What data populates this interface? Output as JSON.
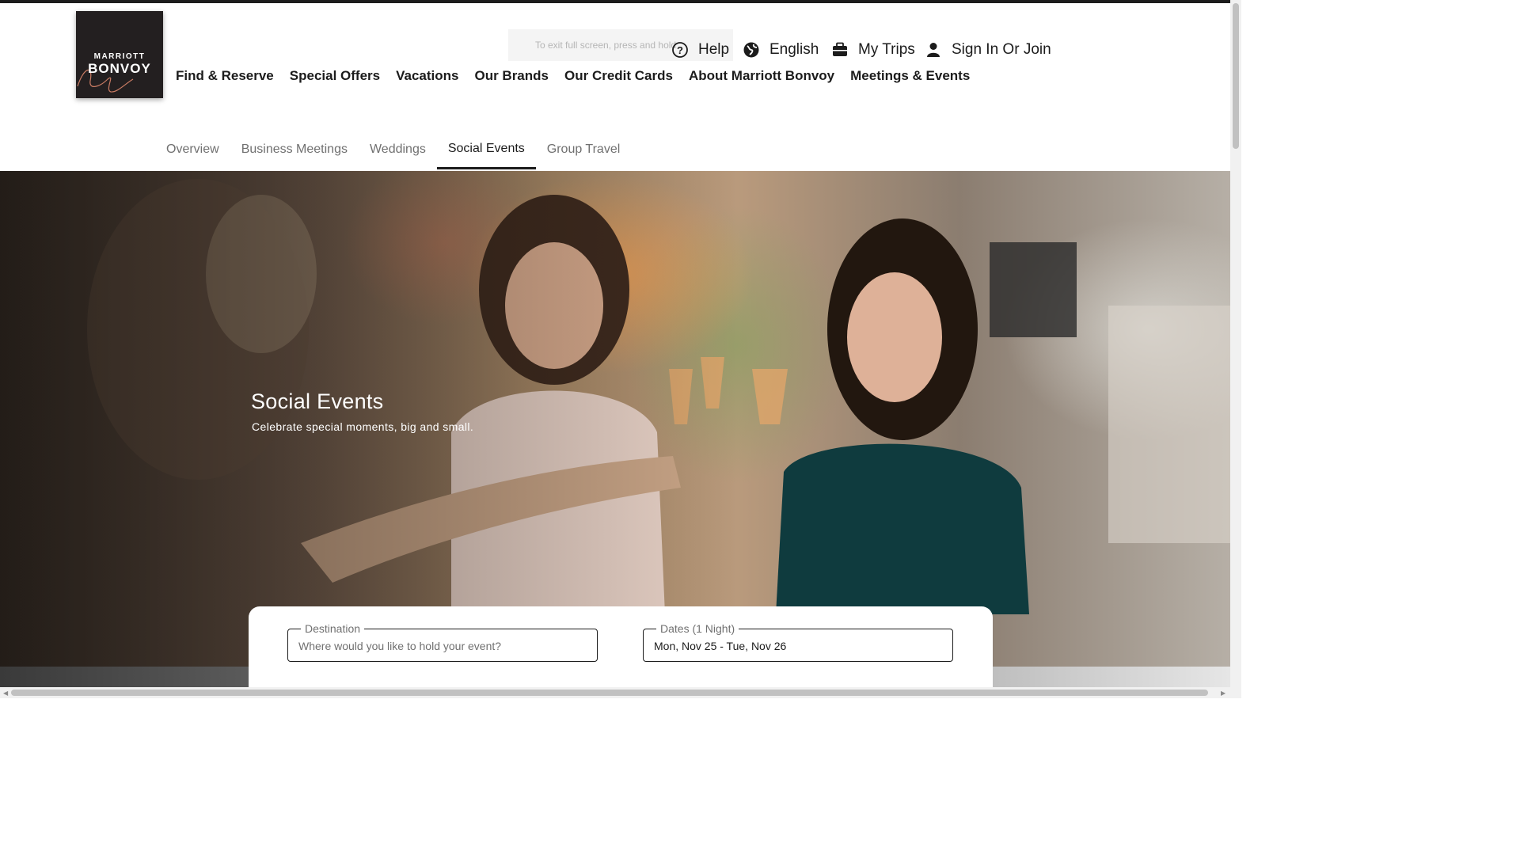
{
  "logo": {
    "line1": "MARRIOTT",
    "line2": "BONVOY"
  },
  "skip_link": "To exit full screen, press and hold",
  "utility_nav": {
    "help": "Help",
    "language": "English",
    "trips": "My Trips",
    "account": "Sign In Or Join"
  },
  "main_nav": [
    "Find & Reserve",
    "Special Offers",
    "Vacations",
    "Our Brands",
    "Our Credit Cards",
    "About Marriott Bonvoy",
    "Meetings & Events"
  ],
  "sub_nav": {
    "tabs": [
      "Overview",
      "Business Meetings",
      "Weddings",
      "Social Events",
      "Group Travel"
    ],
    "active": "Social Events"
  },
  "hero": {
    "title": "Social Events",
    "subtitle": "Celebrate special moments, big and small."
  },
  "search": {
    "destination_label": "Destination",
    "destination_placeholder": "Where would you like to hold your event?",
    "dates_label": "Dates (1 Night)",
    "dates_value": "Mon, Nov 25 - Tue, Nov 26"
  },
  "colors": {
    "text": "#1c1c1c",
    "muted": "#707070",
    "logo_bg": "#231f20"
  }
}
